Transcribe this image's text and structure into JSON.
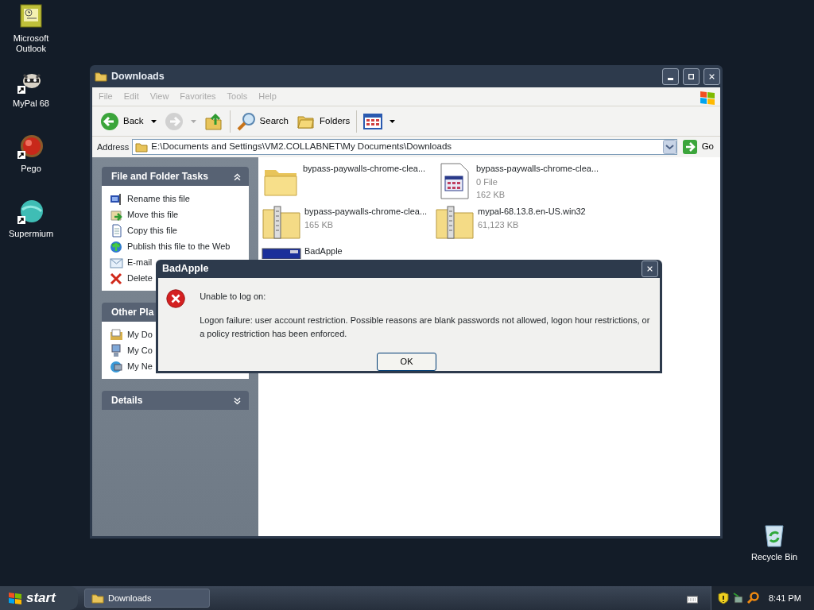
{
  "desktop_icons": [
    {
      "label": "Microsoft Outlook",
      "kind": "outlook",
      "shortcut": false
    },
    {
      "label": "MyPal 68",
      "kind": "mypal",
      "shortcut": true
    },
    {
      "label": "Pego",
      "kind": "pego",
      "shortcut": true
    },
    {
      "label": "Supermium",
      "kind": "supermium",
      "shortcut": true
    },
    {
      "label": "Recycle Bin",
      "kind": "recycle",
      "shortcut": false
    }
  ],
  "explorer": {
    "title": "Downloads",
    "menu": [
      {
        "label": "File",
        "disabled": true
      },
      {
        "label": "Edit",
        "disabled": true
      },
      {
        "label": "View",
        "disabled": true
      },
      {
        "label": "Favorites",
        "disabled": true
      },
      {
        "label": "Tools",
        "disabled": true
      },
      {
        "label": "Help",
        "disabled": true
      }
    ],
    "toolbar": [
      {
        "kind": "back",
        "label": "Back",
        "disabled": false
      },
      {
        "kind": "forward",
        "disabled": true
      },
      {
        "kind": "up",
        "disabled": false
      },
      {
        "kind": "search",
        "label": "Search",
        "disabled": false
      },
      {
        "kind": "folders",
        "label": "Folders",
        "disabled": false
      },
      {
        "kind": "views",
        "disabled": false
      }
    ],
    "address": {
      "label": "Address",
      "value": "E:\\Documents and Settings\\VM2.COLLABNET\\My Documents\\Downloads",
      "go": "Go"
    },
    "task_panes": [
      {
        "title": "File and Folder Tasks",
        "expanded": true,
        "items": [
          {
            "label": "Rename this file",
            "kind": "rename"
          },
          {
            "label": "Move this file",
            "kind": "move"
          },
          {
            "label": "Copy this file",
            "kind": "copy"
          },
          {
            "label": "Publish this file to the Web",
            "kind": "publish"
          },
          {
            "label": "E-mail",
            "kind": "email"
          },
          {
            "label": "Delete",
            "kind": "delete"
          }
        ]
      },
      {
        "title": "Other Pla",
        "expanded": true,
        "items": [
          {
            "label": "My Do",
            "kind": "documents"
          },
          {
            "label": "My Co",
            "kind": "computer"
          },
          {
            "label": "My Ne",
            "kind": "network"
          }
        ]
      },
      {
        "title": "Details",
        "expanded": false
      }
    ],
    "files": [
      {
        "name": "bypass-paywalls-chrome-clea...",
        "kind": "folder"
      },
      {
        "name": "bypass-paywalls-chrome-clea...",
        "kind": "document",
        "details": [
          "0 File",
          "162 KB"
        ]
      },
      {
        "name": "bypass-paywalls-chrome-clea...",
        "kind": "zip",
        "details": [
          "165 KB"
        ]
      },
      {
        "name": "mypal-68.13.8.en-US.win32",
        "kind": "zip",
        "details": [
          "61,123 KB"
        ]
      },
      {
        "name": "BadApple",
        "kind": "app"
      }
    ]
  },
  "dialog": {
    "title": "BadApple",
    "kind": "error",
    "lines": [
      "Unable to log on:",
      "Logon failure: user account restriction.  Possible reasons are blank passwords not allowed, logon hour restrictions, or a policy restriction has been enforced."
    ],
    "button": "OK"
  },
  "taskbar": {
    "start": "start",
    "tasks": [
      {
        "label": "Downloads",
        "selected": false
      }
    ],
    "clock": "8:41 PM"
  }
}
